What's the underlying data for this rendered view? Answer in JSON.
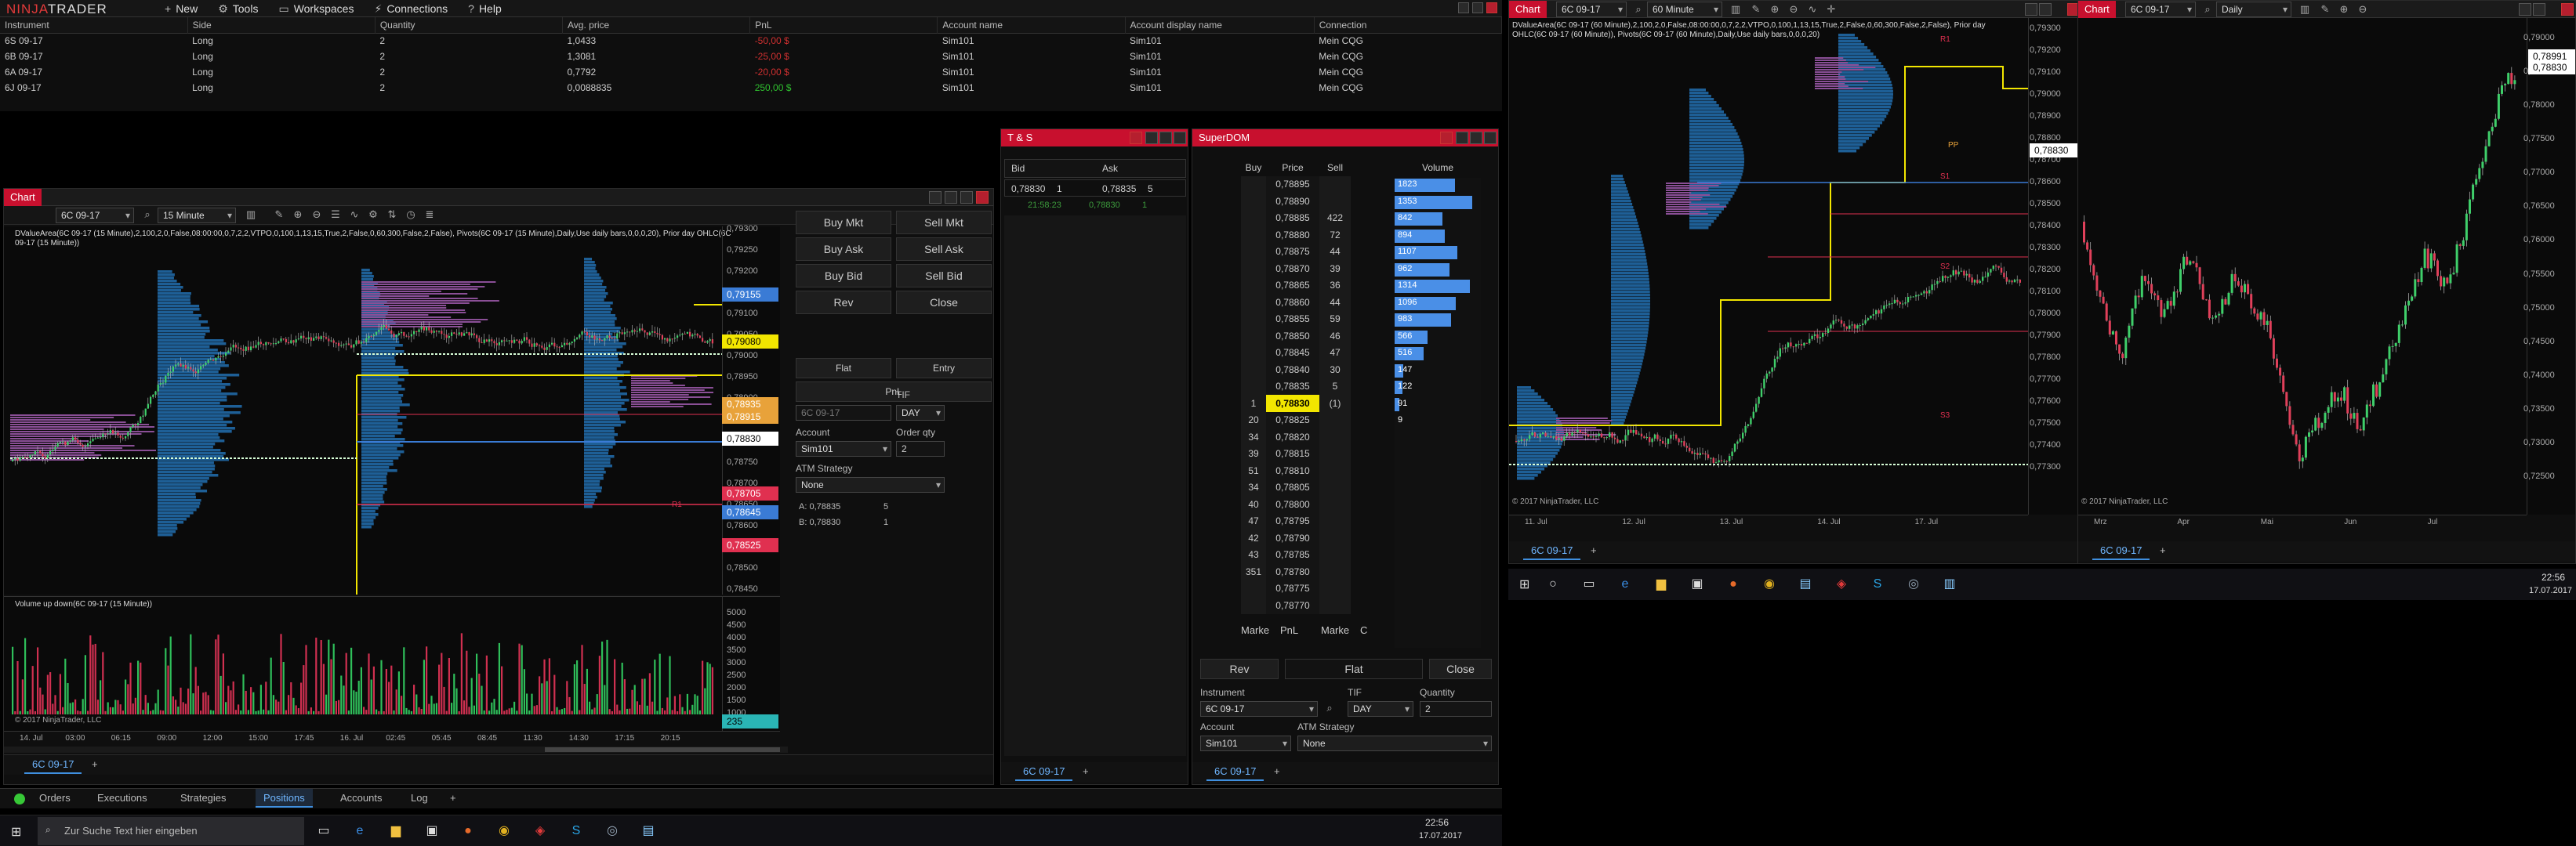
{
  "app": {
    "logo_left": "NINJA",
    "logo_right": "TRADER",
    "menu": [
      {
        "label": "New",
        "icon": "plus-icon"
      },
      {
        "label": "Tools",
        "icon": "gear-icon"
      },
      {
        "label": "Workspaces",
        "icon": "folder-icon"
      },
      {
        "label": "Connections",
        "icon": "plug-icon"
      },
      {
        "label": "Help",
        "icon": "help-icon"
      }
    ]
  },
  "positions": {
    "columns": [
      "Instrument",
      "Side",
      "Quantity",
      "Avg. price",
      "PnL",
      "Account name",
      "Account display name",
      "Connection"
    ],
    "rows": [
      {
        "instrument": "6S 09-17",
        "side": "Long",
        "quantity": "2",
        "avg_price": "1,0433",
        "pnl": "-50,00 $",
        "pnl_color": "#d03030",
        "account": "Sim101",
        "display": "Sim101",
        "connection": "Mein CQG"
      },
      {
        "instrument": "6B 09-17",
        "side": "Long",
        "quantity": "2",
        "avg_price": "1,3081",
        "pnl": "-25,00 $",
        "pnl_color": "#d03030",
        "account": "Sim101",
        "display": "Sim101",
        "connection": "Mein CQG"
      },
      {
        "instrument": "6A 09-17",
        "side": "Long",
        "quantity": "2",
        "avg_price": "0,7792",
        "pnl": "-20,00 $",
        "pnl_color": "#d03030",
        "account": "Sim101",
        "display": "Sim101",
        "connection": "Mein CQG"
      },
      {
        "instrument": "6J 09-17",
        "side": "Long",
        "quantity": "2",
        "avg_price": "0,0088835",
        "pnl": "250,00 $",
        "pnl_color": "#2fc02f",
        "account": "Sim101",
        "display": "Sim101",
        "connection": "Mein CQG"
      }
    ]
  },
  "chart1": {
    "title": "Chart",
    "instrument": "6C 09-17",
    "interval": "15 Minute",
    "indicator_text": "DValueArea(6C 09-17 (15 Minute),2,100,2,0,False,08:00:00,0,7,2,2,VTPO,0,100,1,13,15,True,2,False,0,60,300,False,2,False), Pivots(6C 09-17 (15 Minute),Daily,Use daily bars,0,0,0,20), Prior day OHLC(6C 09-17 (15 Minute))",
    "prices": [
      "0,79300",
      "0,79250",
      "0,79200",
      "0,79150",
      "0,79100",
      "0,79050",
      "0,79000",
      "0,78950",
      "0,78900",
      "0,78850",
      "0,78800",
      "0,78750",
      "0,78700",
      "0,78650",
      "0,78600",
      "0,78550",
      "0,78500",
      "0,78450"
    ],
    "tags": [
      {
        "text": "0,79155",
        "color": "#3a7bd5"
      },
      {
        "text": "0,79080",
        "color": "#f2e600"
      },
      {
        "text": "0,78935",
        "color": "#e8a23a"
      },
      {
        "text": "0,78915",
        "color": "#e8a23a"
      },
      {
        "text": "0,78830",
        "color": "#ffffff"
      },
      {
        "text": "0,78705",
        "color": "#e03050"
      },
      {
        "text": "0,78645",
        "color": "#3a7bd5"
      },
      {
        "text": "0,78525",
        "color": "#e03050"
      }
    ],
    "volume_title": "Volume up down(6C 09-17 (15 Minute))",
    "volume_axis": [
      "5000",
      "4500",
      "4000",
      "3500",
      "3000",
      "2500",
      "2000",
      "1500",
      "1000"
    ],
    "volume_tag": "235",
    "time_labels": [
      "14. Jul",
      "03:00",
      "06:15",
      "09:00",
      "12:00",
      "15:00",
      "17:45",
      "16. Jul",
      "02:45",
      "05:45",
      "08:45",
      "11:30",
      "14:30",
      "17:15",
      "20:15"
    ],
    "copyright": "© 2017 NinjaTrader, LLC",
    "tab": "6C 09-17",
    "r_labels": [
      "R1",
      "S1"
    ]
  },
  "order_entry": {
    "buttons": [
      "Buy Mkt",
      "Sell Mkt",
      "Buy Ask",
      "Sell Ask",
      "Buy Bid",
      "Sell Bid",
      "Rev",
      "Close"
    ],
    "flat_label": "Flat",
    "entry_label": "Entry",
    "pnl_label": "PnL",
    "instrument_label": "Instrument",
    "instrument_value": "6C 09-17",
    "tif_label": "TIF",
    "tif_value": "DAY",
    "account_label": "Account",
    "account_value": "Sim101",
    "qty_label": "Order qty",
    "qty_value": "2",
    "atm_label": "ATM Strategy",
    "atm_value": "None",
    "ask_line": "A: 0,78835",
    "ask_size": "5",
    "bid_line": "B: 0,78830",
    "bid_size": "1"
  },
  "ts": {
    "title": "T & S",
    "bid_label": "Bid",
    "ask_label": "Ask",
    "bid_price": "0,78830",
    "bid_size": "1",
    "ask_price": "0,78835",
    "ask_size": "5",
    "last_time": "21:58:23",
    "last_price": "0,78830",
    "last_size": "1",
    "tab": "6C 09-17"
  },
  "superdom": {
    "title": "SuperDOM",
    "col_buy": "Buy",
    "col_price": "Price",
    "col_sell": "Sell",
    "col_volume": "Volume",
    "rows": [
      {
        "buy": "",
        "price": "0,78895",
        "sell": ""
      },
      {
        "buy": "",
        "price": "0,78890",
        "sell": ""
      },
      {
        "buy": "",
        "price": "0,78885",
        "sell": "422"
      },
      {
        "buy": "",
        "price": "0,78880",
        "sell": "72"
      },
      {
        "buy": "",
        "price": "0,78875",
        "sell": "44"
      },
      {
        "buy": "",
        "price": "0,78870",
        "sell": "39"
      },
      {
        "buy": "",
        "price": "0,78865",
        "sell": "36"
      },
      {
        "buy": "",
        "price": "0,78860",
        "sell": "44"
      },
      {
        "buy": "",
        "price": "0,78855",
        "sell": "59"
      },
      {
        "buy": "",
        "price": "0,78850",
        "sell": "46"
      },
      {
        "buy": "",
        "price": "0,78845",
        "sell": "47"
      },
      {
        "buy": "",
        "price": "0,78840",
        "sell": "30"
      },
      {
        "buy": "",
        "price": "0,78835",
        "sell": "5"
      },
      {
        "buy": "1",
        "price": "0,78830",
        "sell": "(1)"
      },
      {
        "buy": "20",
        "price": "0,78825",
        "sell": ""
      },
      {
        "buy": "34",
        "price": "0,78820",
        "sell": ""
      },
      {
        "buy": "39",
        "price": "0,78815",
        "sell": ""
      },
      {
        "buy": "51",
        "price": "0,78810",
        "sell": ""
      },
      {
        "buy": "34",
        "price": "0,78805",
        "sell": ""
      },
      {
        "buy": "40",
        "price": "0,78800",
        "sell": ""
      },
      {
        "buy": "47",
        "price": "0,78795",
        "sell": ""
      },
      {
        "buy": "42",
        "price": "0,78790",
        "sell": ""
      },
      {
        "buy": "43",
        "price": "0,78785",
        "sell": ""
      },
      {
        "buy": "351",
        "price": "0,78780",
        "sell": ""
      },
      {
        "buy": "",
        "price": "0,78775",
        "sell": ""
      },
      {
        "buy": "",
        "price": "0,78770",
        "sell": ""
      }
    ],
    "volumes": [
      {
        "label": "1823",
        "frac": 0.48
      },
      {
        "label": "1353",
        "frac": 0.62
      },
      {
        "label": "842",
        "frac": 0.38
      },
      {
        "label": "894",
        "frac": 0.4
      },
      {
        "label": "1107",
        "frac": 0.5
      },
      {
        "label": "962",
        "frac": 0.44
      },
      {
        "label": "1314",
        "frac": 0.6
      },
      {
        "label": "1096",
        "frac": 0.49
      },
      {
        "label": "983",
        "frac": 0.45
      },
      {
        "label": "566",
        "frac": 0.26
      },
      {
        "label": "516",
        "frac": 0.23
      },
      {
        "label": "147",
        "frac": 0.07
      },
      {
        "label": "122",
        "frac": 0.06
      },
      {
        "label": "91",
        "frac": 0.04
      },
      {
        "label": "9",
        "frac": 0.0
      }
    ],
    "footer": [
      "Marke",
      "PnL",
      "Marke",
      "C"
    ],
    "rev": "Rev",
    "flat": "Flat",
    "close": "Close",
    "instrument_label": "Instrument",
    "instrument_value": "6C 09-17",
    "tif_label": "TIF",
    "tif_value": "DAY",
    "qty_label": "Quantity",
    "qty_value": "2",
    "account_label": "Account",
    "account_value": "Sim101",
    "atm_label": "ATM Strategy",
    "atm_value": "None",
    "tab": "6C 09-17"
  },
  "bottom_tabs": [
    "Orders",
    "Executions",
    "Strategies",
    "Positions",
    "Accounts",
    "Log"
  ],
  "chart2": {
    "title": "Chart",
    "instrument": "6C 09-17",
    "interval": "60 Minute",
    "indicator_text": "DValueArea(6C 09-17 (60 Minute),2,100,2,0,False,08:00:00,0,7,2,2,VTPO,0,100,1,13,15,True,2,False,0,60,300,False,2,False), Prior day OHLC(6C 09-17 (60 Minute)), Pivots(6C 09-17 (60 Minute),Daily,Use daily bars,0,0,0,20)",
    "prices": [
      "0,79300",
      "0,79200",
      "0,79100",
      "0,79000",
      "0,78900",
      "0,78800",
      "0,78700",
      "0,78600",
      "0,78500",
      "0,78400",
      "0,78300",
      "0,78200",
      "0,78100",
      "0,78000",
      "0,77900",
      "0,77800",
      "0,77700",
      "0,77600",
      "0,77500",
      "0,77400",
      "0,77300"
    ],
    "tag": "0,78830",
    "time_labels": [
      "11. Jul",
      "12. Jul",
      "13. Jul",
      "14. Jul",
      "17. Jul"
    ],
    "copyright": "© 2017 NinjaTrader, LLC",
    "tab": "6C 09-17",
    "labels": [
      "R1",
      "S1",
      "S2",
      "S3",
      "PP"
    ]
  },
  "chart3": {
    "title": "Chart",
    "instrument": "6C 09-17",
    "interval": "Daily",
    "prices": [
      "0,79000",
      "0,78500",
      "0,78000",
      "0,77500",
      "0,77000",
      "0,76500",
      "0,76000",
      "0,75500",
      "0,75000",
      "0,74500",
      "0,74000",
      "0,73500",
      "0,73000",
      "0,72500"
    ],
    "tags": [
      "0,78991",
      "0,78830"
    ],
    "time_labels": [
      "Mrz",
      "Apr",
      "Mai",
      "Jun",
      "Jul"
    ],
    "copyright": "© 2017 NinjaTrader, LLC",
    "tab": "6C 09-17"
  },
  "taskbar_left": {
    "search_placeholder": "Zur Suche Text hier eingeben",
    "time": "22:56",
    "date": "17.07.2017"
  },
  "taskbar_right": {
    "time": "22:56",
    "date": "17.07.2017"
  }
}
